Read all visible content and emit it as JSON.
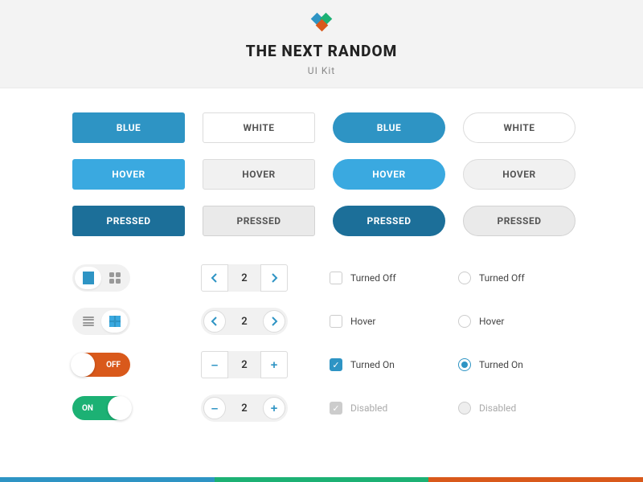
{
  "header": {
    "title": "THE NEXT RANDOM",
    "subtitle": "UI Kit"
  },
  "buttons": {
    "blue": "BLUE",
    "white": "WHITE",
    "hover": "HOVER",
    "pressed": "PRESSED"
  },
  "stepper": {
    "value": "2"
  },
  "toggle": {
    "off": "OFF",
    "on": "ON"
  },
  "states": {
    "turned_off": "Turned Off",
    "hover": "Hover",
    "turned_on": "Turned On",
    "disabled": "Disabled"
  },
  "colors": {
    "blue": "#2e94c4",
    "green": "#1cb174",
    "orange": "#d9591b"
  }
}
